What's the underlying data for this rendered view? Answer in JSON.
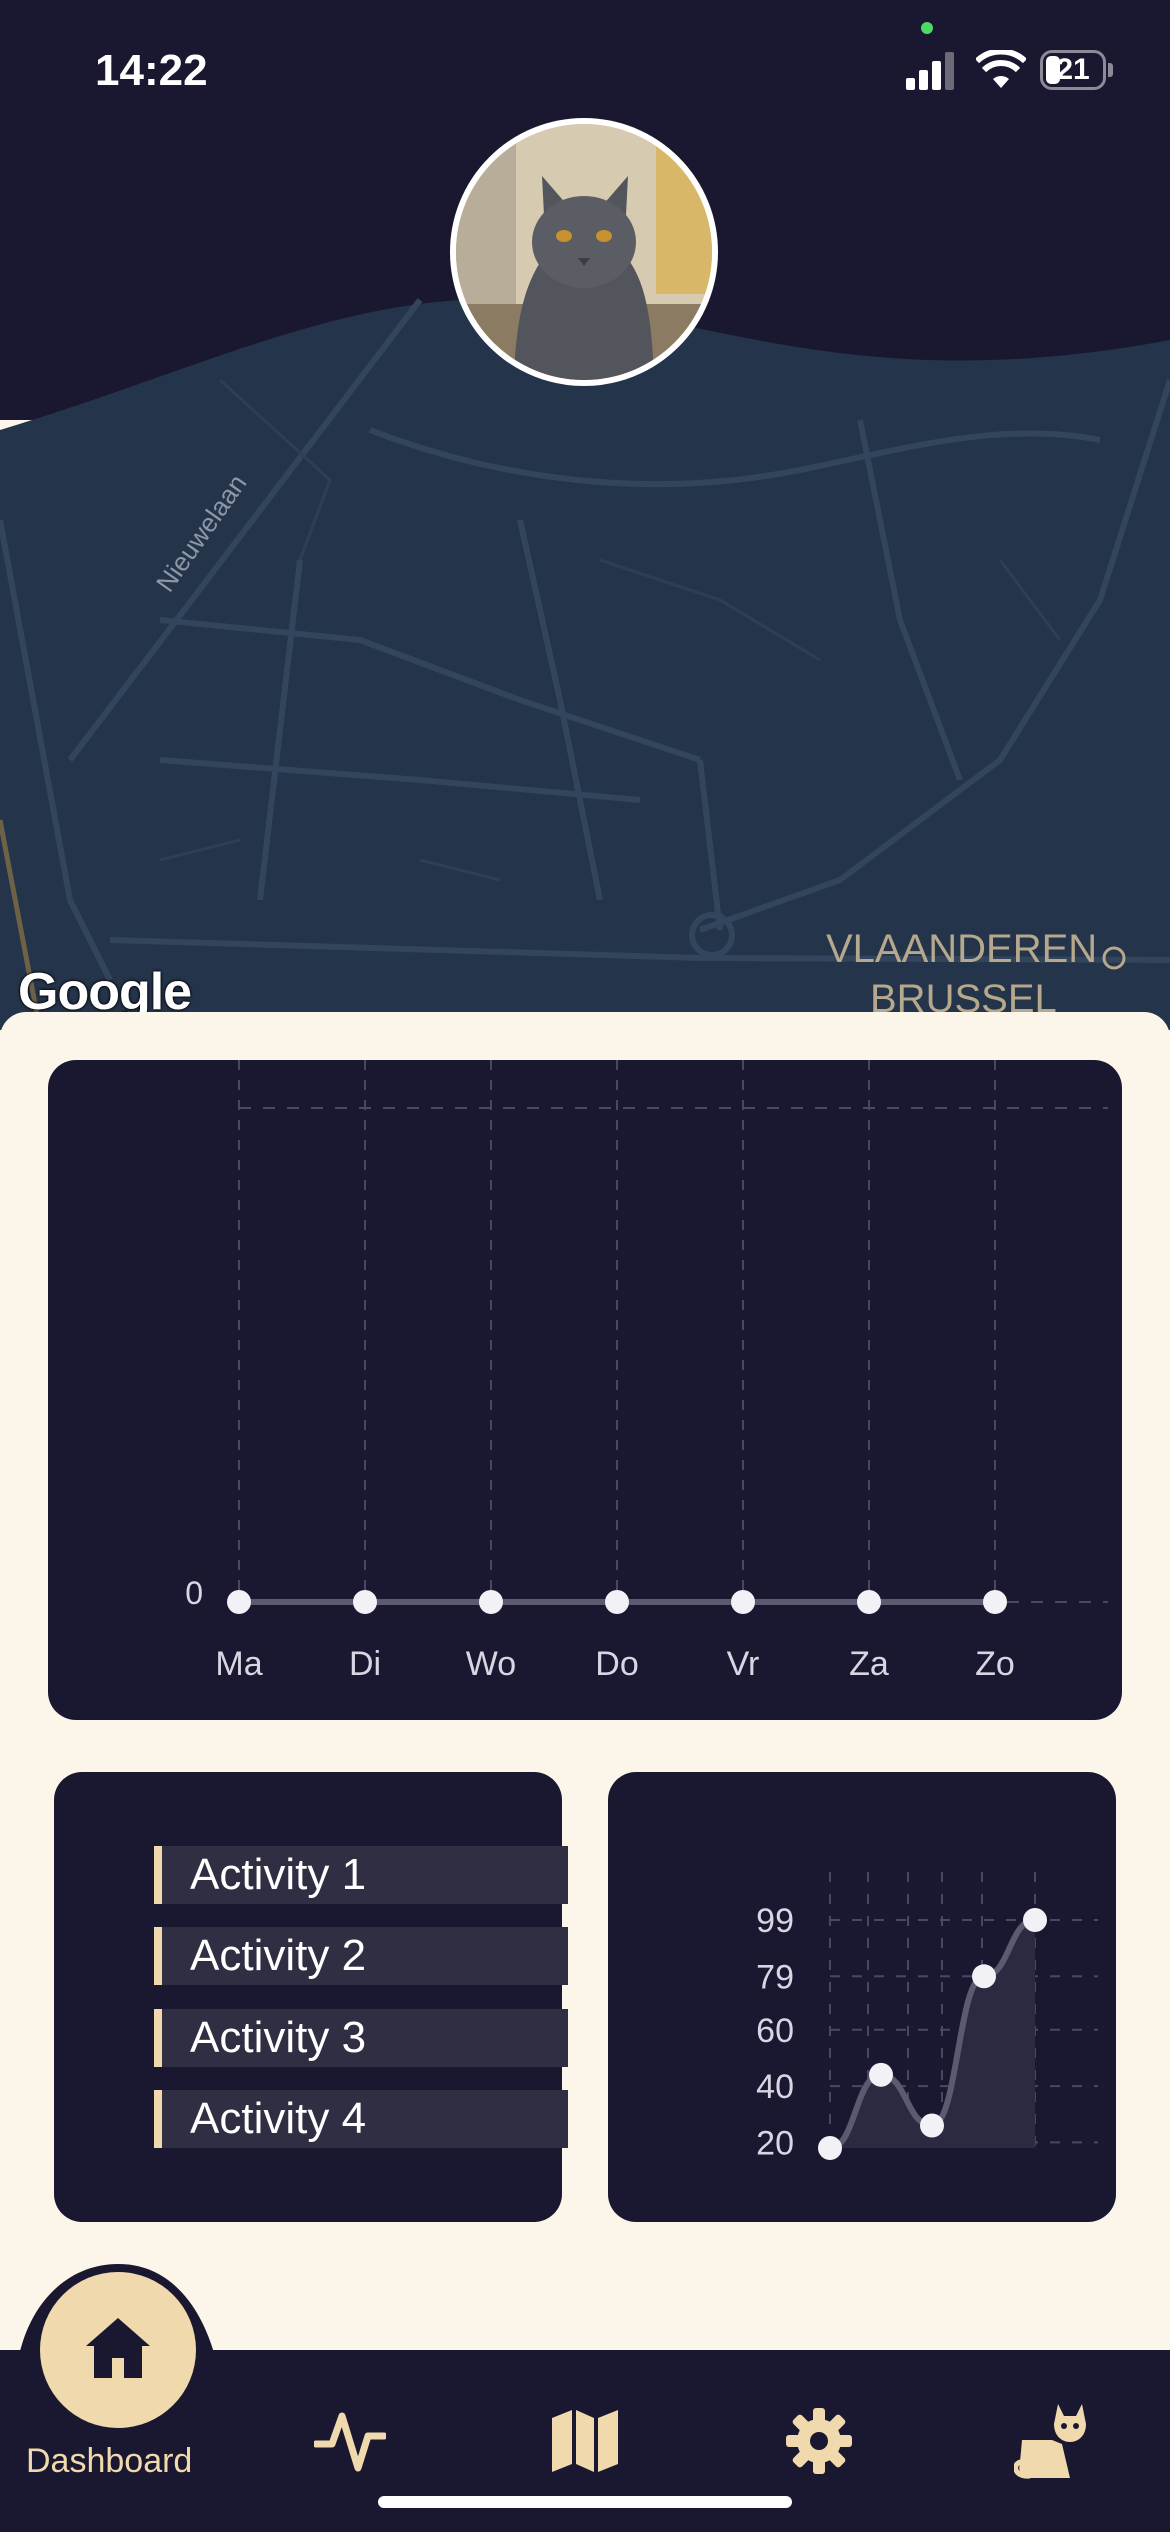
{
  "status_bar": {
    "time": "14:22",
    "battery": "21"
  },
  "map": {
    "street_label": "Nieuwelaan",
    "city_label_line1": "VLAANDEREN",
    "city_label_line2": "BRUSSEL",
    "attribution": "Google"
  },
  "profile": {
    "avatar": "cat-photo"
  },
  "chart_data": [
    {
      "type": "line",
      "categories": [
        "Ma",
        "Di",
        "Wo",
        "Do",
        "Vr",
        "Za",
        "Zo"
      ],
      "series": [
        {
          "values": [
            0,
            0,
            0,
            0,
            0,
            0,
            0
          ]
        }
      ],
      "y_tick_labels": [
        "0"
      ],
      "grid": true
    },
    {
      "type": "area",
      "x": [
        1,
        2,
        3,
        4,
        5
      ],
      "series": [
        {
          "values": [
            18,
            44,
            26,
            79,
            99
          ]
        }
      ],
      "y_tick_labels": [
        "20",
        "40",
        "60",
        "79",
        "99"
      ],
      "ylim": [
        18,
        99
      ],
      "grid": true
    }
  ],
  "activities": [
    {
      "label": "Activity 1"
    },
    {
      "label": "Activity 2"
    },
    {
      "label": "Activity 3"
    },
    {
      "label": "Activity 4"
    }
  ],
  "nav": {
    "active_label": "Dashboard",
    "items": [
      {
        "icon": "home-icon"
      },
      {
        "icon": "activity-icon"
      },
      {
        "icon": "map-icon"
      },
      {
        "icon": "gear-icon"
      },
      {
        "icon": "cat-icon"
      }
    ]
  },
  "colors": {
    "dark": "#1a1830",
    "cream": "#fcf5ea",
    "accent": "#f0d9ad",
    "map": "#24344a"
  }
}
